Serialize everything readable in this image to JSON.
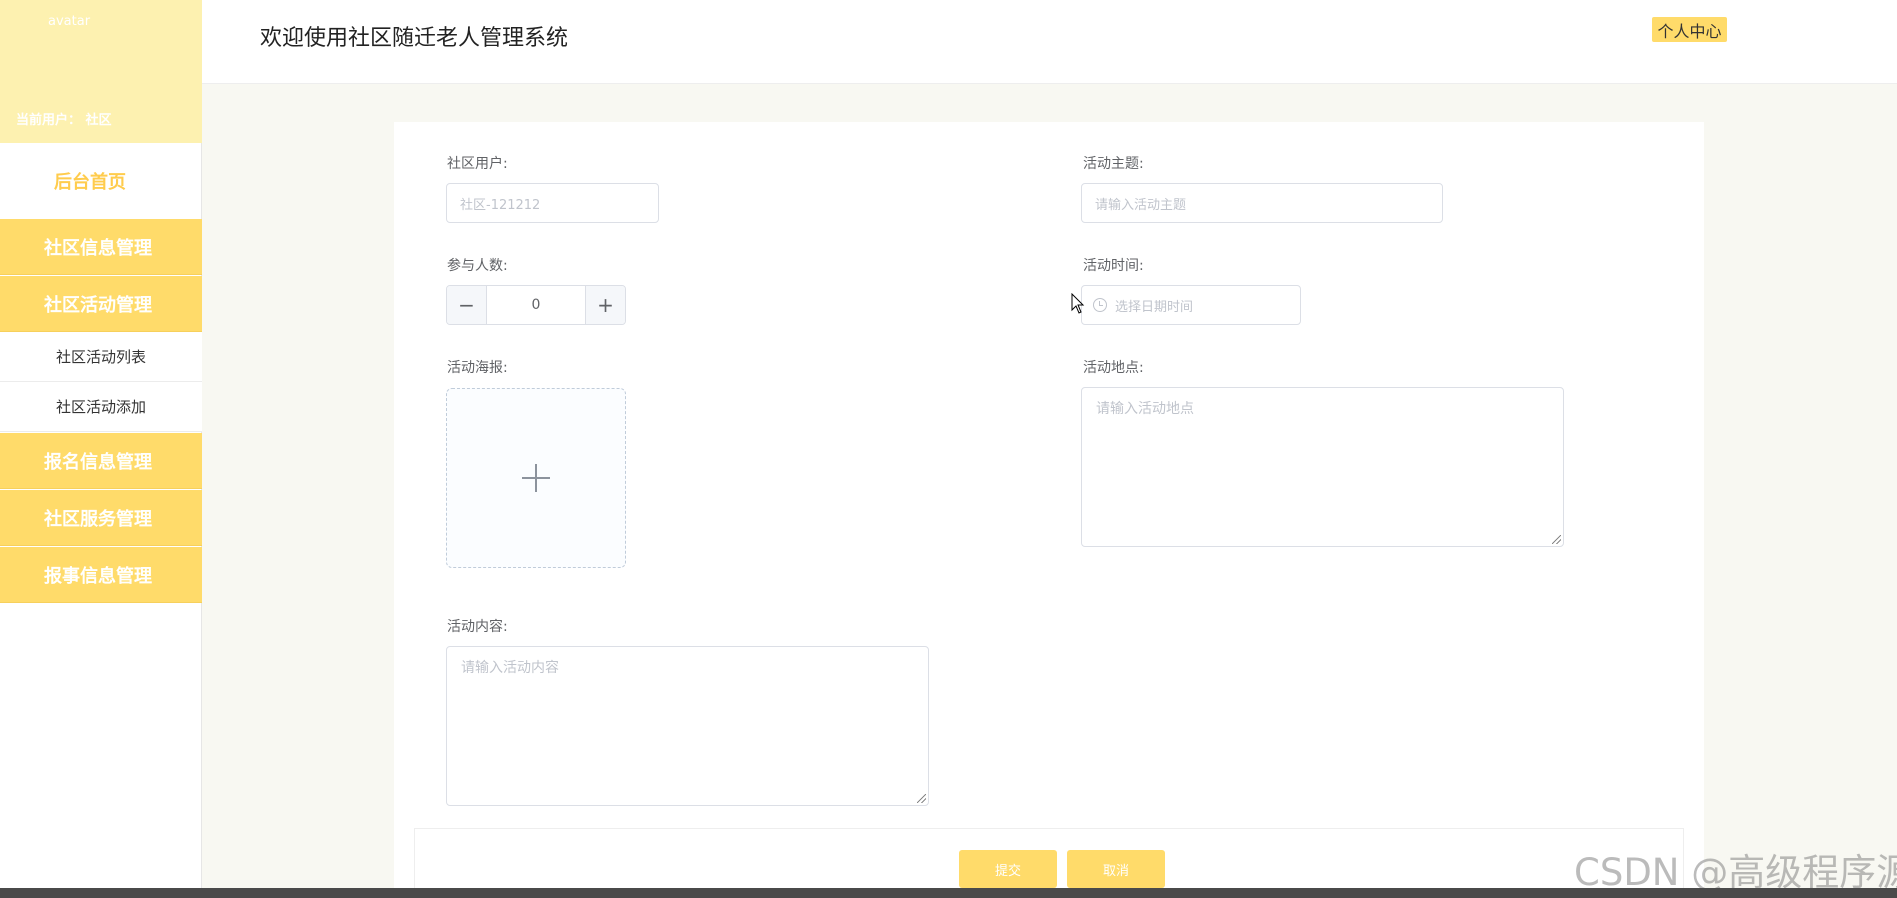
{
  "header": {
    "welcome_text": "欢迎使用社区随迁老人管理系统",
    "personal_center": "个人中心"
  },
  "sidebar": {
    "avatar_alt": "avatar",
    "current_user": "当前用户：  社区",
    "home": "后台首页",
    "groups": [
      {
        "label": "社区信息管理"
      },
      {
        "label": "社区活动管理",
        "children": [
          "社区活动列表",
          "社区活动添加"
        ]
      },
      {
        "label": "报名信息管理"
      },
      {
        "label": "社区服务管理"
      },
      {
        "label": "报事信息管理"
      }
    ]
  },
  "form": {
    "community_user": {
      "label": "社区用户:",
      "value": "社区-121212"
    },
    "activity_theme": {
      "label": "活动主题:",
      "placeholder": "请输入活动主题"
    },
    "participants": {
      "label": "参与人数:",
      "value": "0",
      "minus": "−",
      "plus": "+"
    },
    "activity_time": {
      "label": "活动时间:",
      "placeholder": "选择日期时间"
    },
    "poster": {
      "label": "活动海报:"
    },
    "location": {
      "label": "活动地点:",
      "placeholder": "请输入活动地点"
    },
    "content": {
      "label": "活动内容:",
      "placeholder": "请输入活动内容"
    },
    "submit": "提交",
    "cancel": "取消"
  },
  "watermark": "CSDN @高级程序源",
  "colors": {
    "accent": "#ffdb6a",
    "sidebar_profile": "#fdf1b0",
    "home_text": "#ffcc4d"
  }
}
